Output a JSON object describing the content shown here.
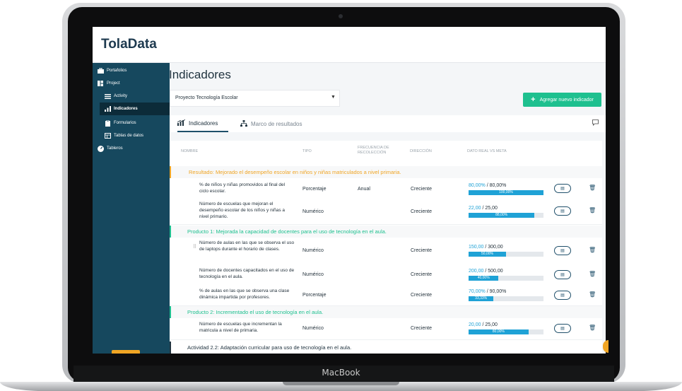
{
  "app": {
    "logo": "TolaData"
  },
  "device_label": "MacBook",
  "colors": {
    "sidebar": "#16485e",
    "accent_green": "#1ec08f",
    "accent_orange": "#f0a524",
    "bar_blue": "#1fa2d6"
  },
  "sidebar": {
    "items": [
      {
        "label": "Portafolios",
        "icon": "briefcase-icon"
      },
      {
        "label": "Project",
        "icon": "grid-icon"
      },
      {
        "label": "Activity",
        "icon": "list-icon"
      },
      {
        "label": "Indicadores",
        "icon": "bar-chart-icon",
        "active": true
      },
      {
        "label": "Formularios",
        "icon": "clipboard-icon"
      },
      {
        "label": "Tablas de datos",
        "icon": "table-icon"
      },
      {
        "label": "Tableros",
        "icon": "dashboard-icon"
      }
    ]
  },
  "page": {
    "title": "Indicadores"
  },
  "project_select": {
    "value": "Proyecto Tecnología Escolar"
  },
  "add_button": {
    "label": "Agregar nuevo indicador"
  },
  "tabs": [
    {
      "label": "Indicadores",
      "active": true
    },
    {
      "label": "Marco de resultados",
      "active": false
    }
  ],
  "table": {
    "headers": {
      "nombre": "NOMBRE",
      "tipo": "TIPO",
      "frecuencia": "FRECUENCIA DE RECOLECCIÓN",
      "direccion": "DIRECCIÓN",
      "dato": "DATO REAL VS META"
    },
    "groups": [
      {
        "title": "Resultado: Mejorado el desempeño escolar en niños y niñas matriculados a nivel primaria.",
        "style": "orange",
        "rows": [
          {
            "name": "% de niños y niñas promovidos al final del ciclo escolar.",
            "tipo": "Porcentaje",
            "frecuencia": "Anual",
            "direccion": "Creciente",
            "real": "80,00%",
            "meta": " / 80,00%",
            "pct_label": "100,00%",
            "progress": 1.0
          },
          {
            "name": "Número de escuelas que mejoran el desempeño escolar de los niños y niñas a nivel primario.",
            "tipo": "Numérico",
            "frecuencia": "",
            "direccion": "Creciente",
            "real": "22,00",
            "meta": " / 25,00",
            "pct_label": "88,00%",
            "progress": 0.88
          }
        ]
      },
      {
        "title": "Producto 1: Mejorada la capacidad de docentes para el uso de tecnología en el aula.",
        "style": "green",
        "rows": [
          {
            "name": "Número de aulas en las que se observa el uso de laptops durante el horario de clases.",
            "tipo": "Numérico",
            "frecuencia": "",
            "direccion": "Creciente",
            "real": "150,00",
            "meta": " / 300,00",
            "pct_label": "50,00%",
            "progress": 0.5
          },
          {
            "name": "Número de docentes capacitados en el uso de tecnología en el aula.",
            "tipo": "Numérico",
            "frecuencia": "",
            "direccion": "Creciente",
            "real": "200,00",
            "meta": " / 500,00",
            "pct_label": "40,00%",
            "progress": 0.4
          },
          {
            "name": "% de aulas en las que se observa una clase dinámica impartida por profesores.",
            "tipo": "Porcentaje",
            "frecuencia": "",
            "direccion": "Creciente",
            "real": "70,00%",
            "meta": " / 90,00%",
            "pct_label": "33,33%",
            "progress": 0.3333
          }
        ]
      },
      {
        "title": "Producto 2: Incrementado el uso de tecnología en el aula.",
        "style": "green",
        "rows": [
          {
            "name": "Número de escuelas que incrementan la matricula a nivel de primaria.",
            "tipo": "Numérico",
            "frecuencia": "",
            "direccion": "Creciente",
            "real": "20,00",
            "meta": " / 25,00",
            "pct_label": "80,00%",
            "progress": 0.8
          }
        ]
      }
    ],
    "footer_activity": "Actividad 2.2: Adaptación curricular para uso de tecnología en el aula."
  }
}
